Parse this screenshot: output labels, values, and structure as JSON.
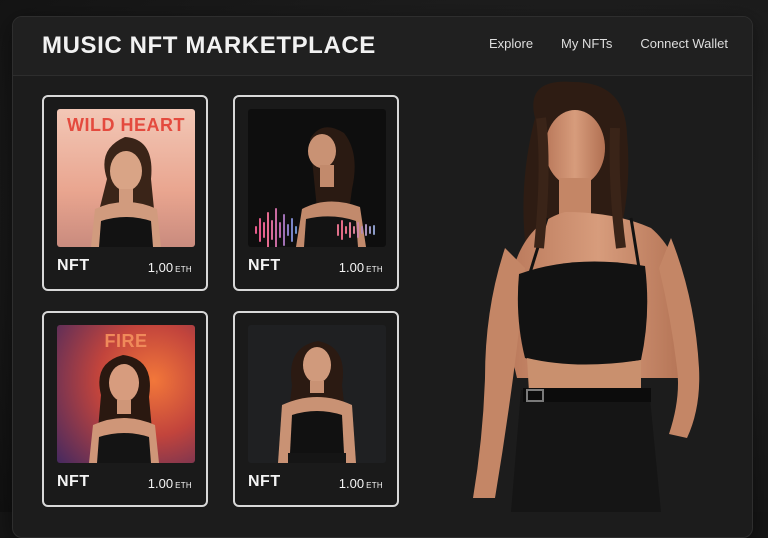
{
  "app": {
    "title": "MUSIC NFT MARKETPLACE"
  },
  "nav": {
    "items": [
      "Explore",
      "My NFTs",
      "Connect Wallet"
    ]
  },
  "cards": [
    {
      "title": "WILD HEART",
      "label": "NFT",
      "price": "1,00",
      "unit": "ETH",
      "title_color": "#e44a3e"
    },
    {
      "title": "",
      "label": "NFT",
      "price": "1.00",
      "unit": "ETH"
    },
    {
      "title": "FIRE",
      "label": "NFT",
      "price": "1.00",
      "unit": "ETH",
      "title_color": "#f08a5a"
    },
    {
      "title": "",
      "label": "NFT",
      "price": "1.00",
      "unit": "ETH"
    }
  ],
  "colors": {
    "background": "#161616",
    "card_border": "#d8d8d8",
    "text": "#f2f2f2"
  }
}
